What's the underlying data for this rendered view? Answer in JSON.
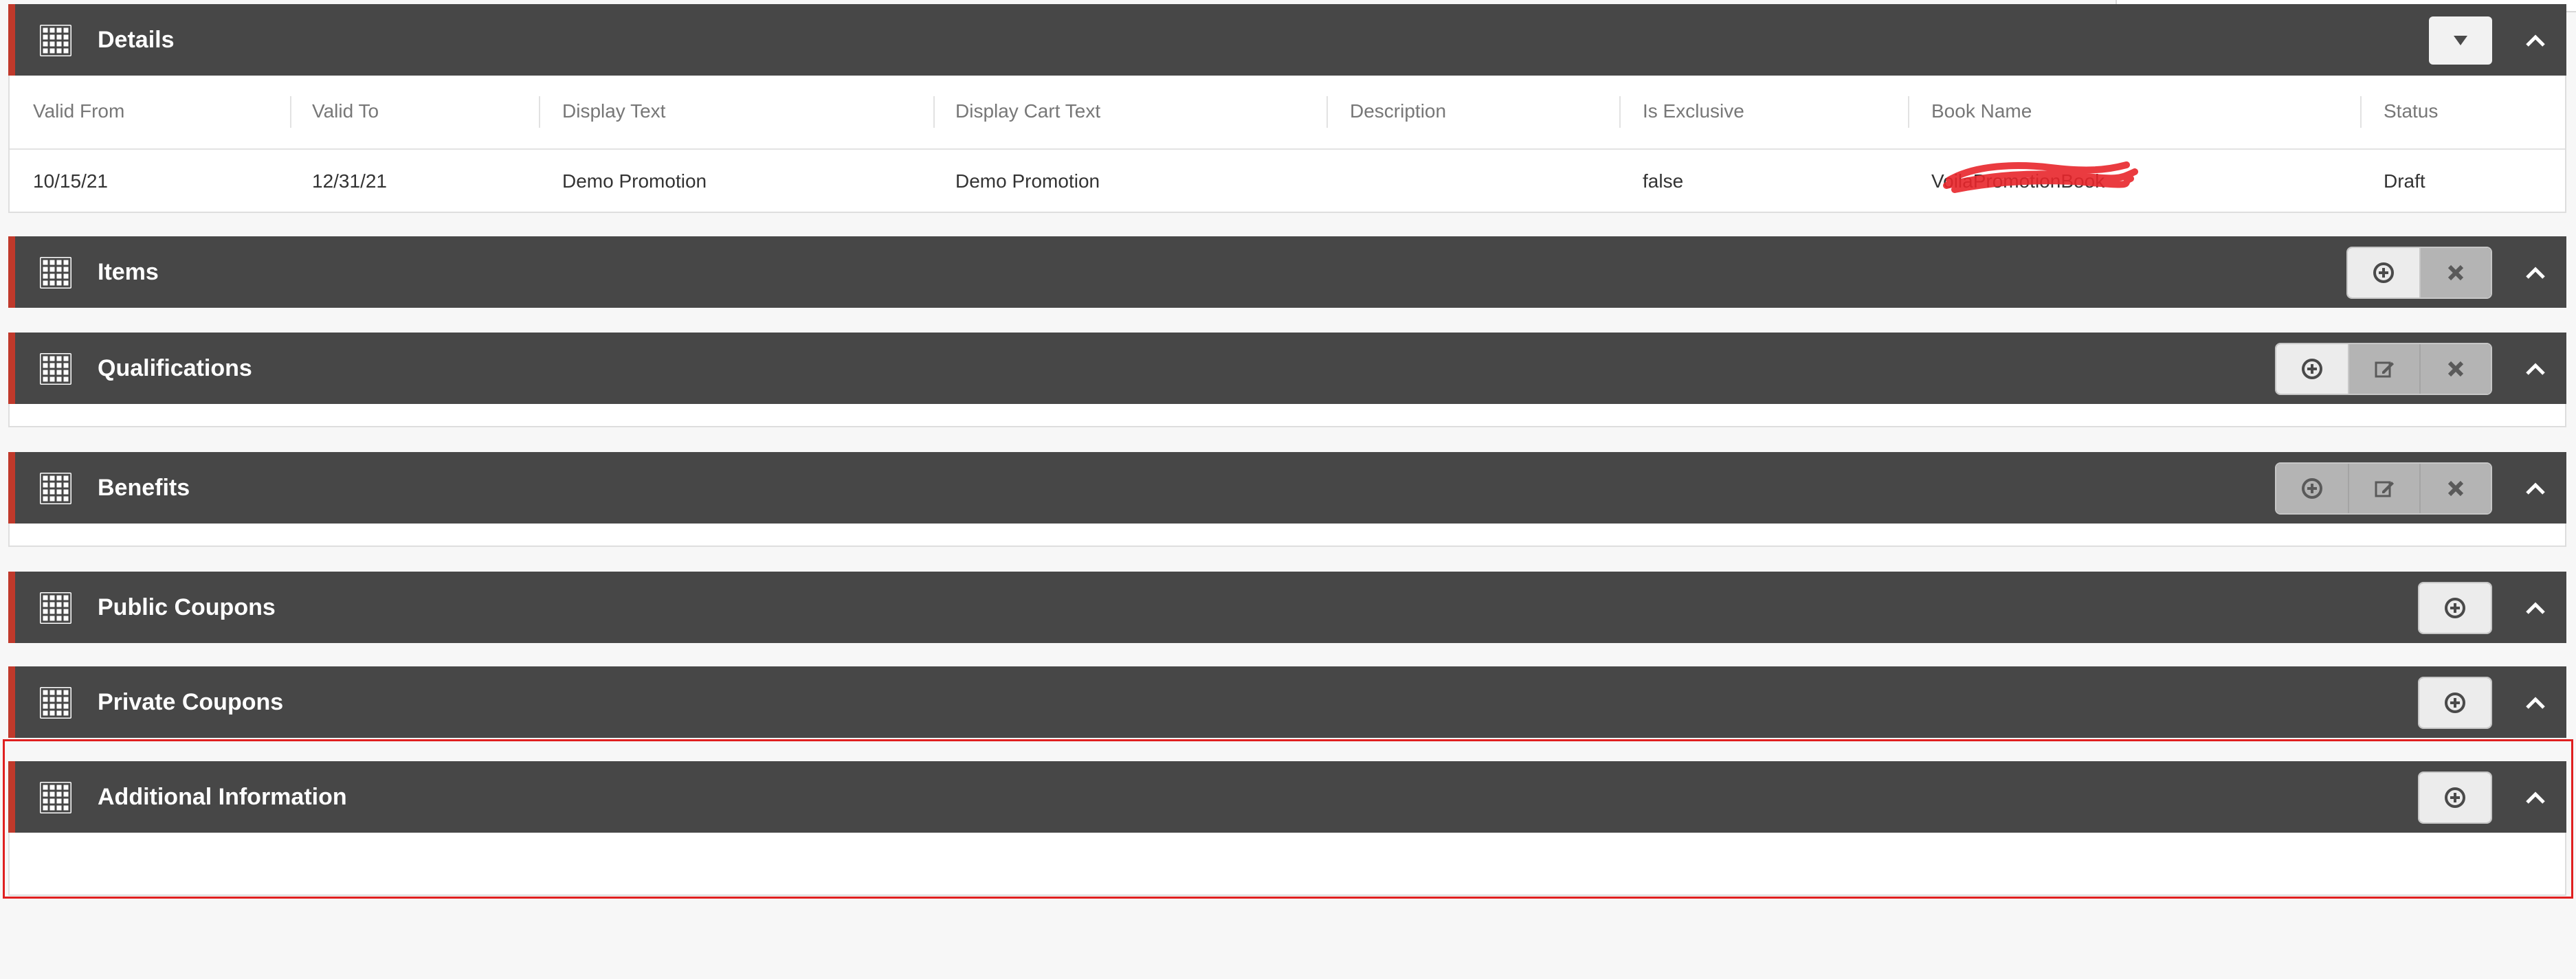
{
  "panels": {
    "details": {
      "title": "Details",
      "columns": [
        "Valid From",
        "Valid To",
        "Display Text",
        "Display Cart Text",
        "Description",
        "Is Exclusive",
        "Book Name",
        "Status"
      ],
      "row": [
        "10/15/21",
        "12/31/21",
        "Demo Promotion",
        "Demo Promotion",
        "",
        "false",
        "VoilaPromotionBook",
        "Draft"
      ]
    },
    "items": {
      "title": "Items"
    },
    "qualifications": {
      "title": "Qualifications"
    },
    "benefits": {
      "title": "Benefits"
    },
    "public_coupons": {
      "title": "Public Coupons"
    },
    "private_coupons": {
      "title": "Private Coupons"
    },
    "additional_information": {
      "title": "Additional Information"
    }
  },
  "icons": {
    "panel": "grid-table-icon",
    "add": "plus-circle-icon",
    "edit": "edit-icon",
    "remove": "close-icon",
    "collapse": "chevron-up-icon",
    "dropdown": "caret-down-icon"
  },
  "colors": {
    "header_bg": "#474747",
    "accent": "#c0392b",
    "highlight_outline": "#e02020"
  }
}
